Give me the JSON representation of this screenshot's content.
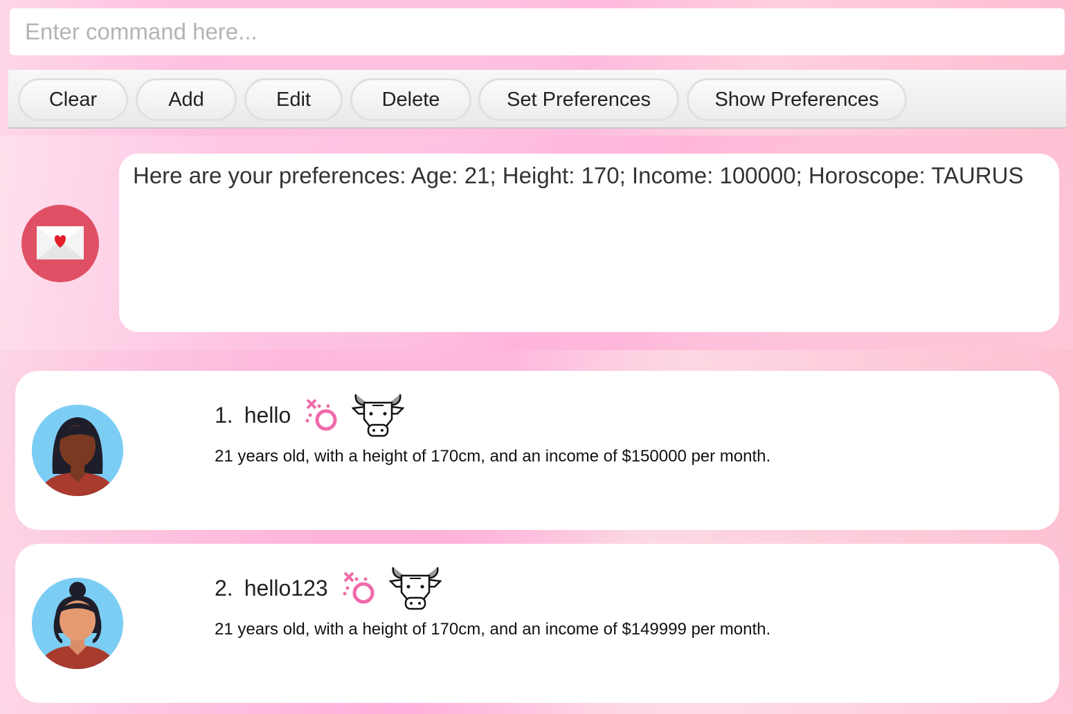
{
  "command": {
    "placeholder": "Enter command here...",
    "value": ""
  },
  "toolbar": {
    "buttons": [
      {
        "label": "Clear"
      },
      {
        "label": "Add"
      },
      {
        "label": "Edit"
      },
      {
        "label": "Delete"
      },
      {
        "label": "Set Preferences"
      },
      {
        "label": "Show Preferences"
      }
    ]
  },
  "result": {
    "icon": "mail-heart-icon",
    "text": "Here are your preferences: Age: 21; Height: 170; Income: 100000; Horoscope: TAURUS"
  },
  "dates": [
    {
      "index": "1.",
      "name": "hello",
      "gender_icon": "gender-female-icon",
      "horoscope_icon": "taurus-bull-icon",
      "description": "21 years old, with a height of 170cm, and an income of $150000 per month.",
      "avatar": "avatar-female-long-hair"
    },
    {
      "index": "2.",
      "name": "hello123",
      "gender_icon": "gender-female-icon",
      "horoscope_icon": "taurus-bull-icon",
      "description": "21 years old, with a height of 170cm, and an income of $149999 per month.",
      "avatar": "avatar-female-bun-hair"
    }
  ],
  "colors": {
    "accent": "#e05064",
    "gender_pink": "#f06aa8",
    "avatar_bg": "#7ccdf3"
  }
}
